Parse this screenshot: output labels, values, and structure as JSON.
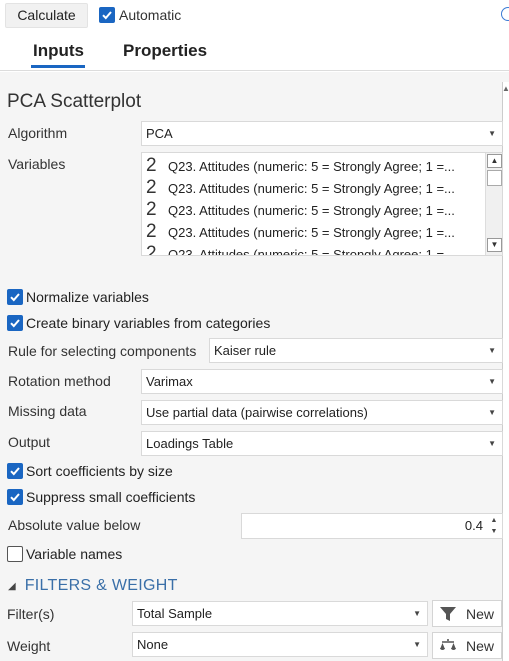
{
  "toolbar": {
    "calculate_label": "Calculate",
    "automatic_label": "Automatic",
    "automatic_checked": true
  },
  "tabs": [
    {
      "label": "Inputs",
      "active": true
    },
    {
      "label": "Properties",
      "active": false
    }
  ],
  "panel": {
    "title": "PCA Scatterplot"
  },
  "algorithm": {
    "label": "Algorithm",
    "value": "PCA"
  },
  "variables": {
    "label": "Variables",
    "items": [
      "Q23. Attitudes (numeric: 5 = Strongly Agree; 1 =...",
      "Q23. Attitudes (numeric: 5 = Strongly Agree; 1 =...",
      "Q23. Attitudes (numeric: 5 = Strongly Agree; 1 =...",
      "Q23. Attitudes (numeric: 5 = Strongly Agree; 1 =...",
      "Q23. Attitudes (numeric: 5 = Strongly Agree; 1 =..."
    ],
    "icon_glyph": "2"
  },
  "normalize": {
    "label": "Normalize variables",
    "checked": true
  },
  "binary": {
    "label": "Create binary variables from categories",
    "checked": true
  },
  "rule": {
    "label": "Rule for selecting components",
    "value": "Kaiser rule"
  },
  "rotation": {
    "label": "Rotation method",
    "value": "Varimax"
  },
  "missing": {
    "label": "Missing data",
    "value": "Use partial data (pairwise correlations)"
  },
  "output": {
    "label": "Output",
    "value": "Loadings Table"
  },
  "sort": {
    "label": "Sort coefficients by size",
    "checked": true
  },
  "suppress": {
    "label": "Suppress small coefficients",
    "checked": true
  },
  "absolute": {
    "label": "Absolute value below",
    "value": "0.4"
  },
  "varnames": {
    "label": "Variable names",
    "checked": false
  },
  "filters_section": {
    "label": "FILTERS & WEIGHT"
  },
  "filter": {
    "label": "Filter(s)",
    "value": "Total Sample",
    "new_label": "New"
  },
  "weight": {
    "label": "Weight",
    "value": "None",
    "new_label": "New"
  },
  "colors": {
    "accent": "#1a66c2",
    "section_text": "#3a6fa8",
    "panel_bg": "#f5f5f5"
  }
}
